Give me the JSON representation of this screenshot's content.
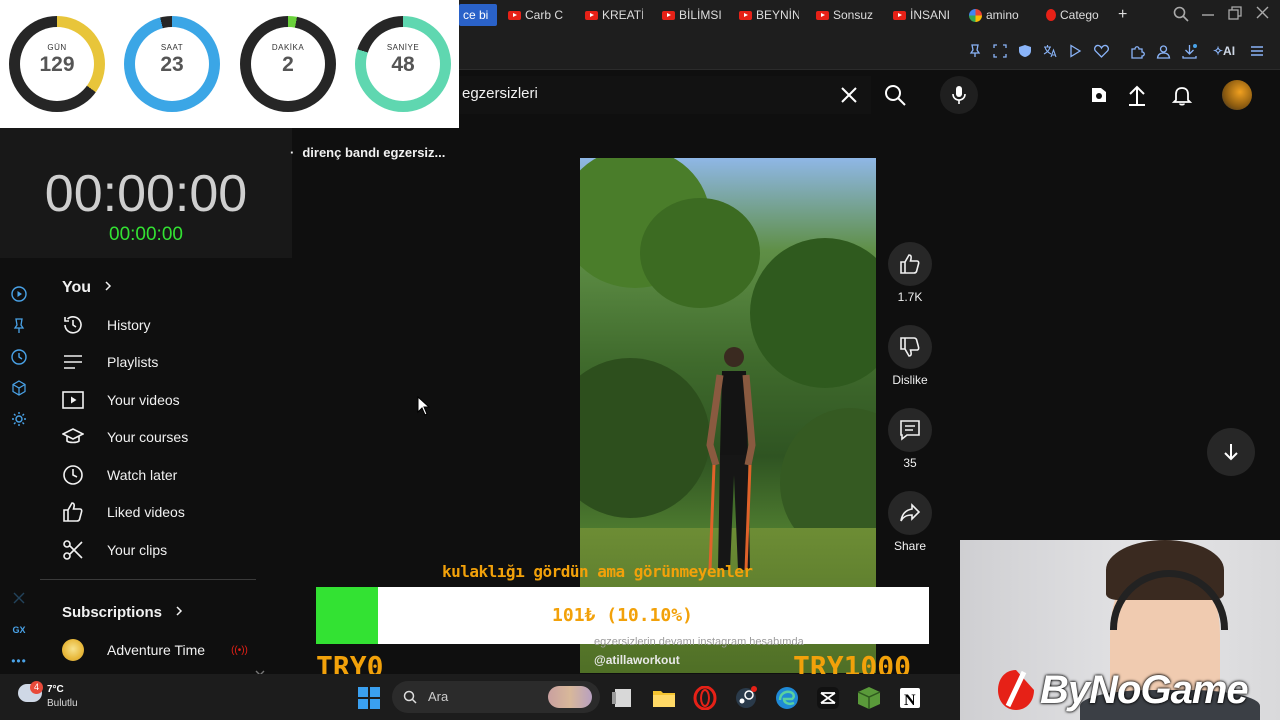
{
  "timer_overlay": {
    "gauges": [
      {
        "label": "GÜN",
        "value": "129",
        "fraction": 0.35,
        "color": "#e8c53a"
      },
      {
        "label": "SAAT",
        "value": "23",
        "fraction": 0.96,
        "color": "#3ba6e6"
      },
      {
        "label": "DAKİKA",
        "value": "2",
        "fraction": 0.03,
        "color": "#6ad13b"
      },
      {
        "label": "SANİYE",
        "value": "48",
        "fraction": 0.8,
        "color": "#5fd7b0"
      }
    ],
    "main_time": "00:00:00",
    "sub_time": "00:00:00"
  },
  "browser": {
    "tabs": [
      {
        "label": "ce bi",
        "icon": "none",
        "active": true
      },
      {
        "label": "Carb C",
        "icon": "youtube-icon"
      },
      {
        "label": "KREATİ",
        "icon": "youtube-icon"
      },
      {
        "label": "BİLİMSI",
        "icon": "youtube-icon"
      },
      {
        "label": "BEYNİN",
        "icon": "youtube-icon"
      },
      {
        "label": "Sonsuz",
        "icon": "youtube-icon"
      },
      {
        "label": "İNSANI",
        "icon": "youtube-icon"
      },
      {
        "label": "amino",
        "icon": "google-icon"
      },
      {
        "label": "Catego",
        "icon": "fire-icon"
      }
    ],
    "new_tab": "+",
    "extension_ai_label": "AI"
  },
  "youtube": {
    "search": {
      "value": "egzersizleri"
    },
    "chip_title": "direnç bandı egzersiz...",
    "guide": {
      "you_label": "You",
      "items": [
        {
          "label": "History",
          "icon": "history-icon"
        },
        {
          "label": "Playlists",
          "icon": "playlists-icon"
        },
        {
          "label": "Your videos",
          "icon": "your-videos-icon"
        },
        {
          "label": "Your courses",
          "icon": "courses-icon"
        },
        {
          "label": "Watch later",
          "icon": "clock-icon"
        },
        {
          "label": "Liked videos",
          "icon": "thumbs-up-icon"
        },
        {
          "label": "Your clips",
          "icon": "scissors-icon"
        }
      ],
      "subscriptions_label": "Subscriptions",
      "subscriptions": [
        {
          "label": "Adventure Time"
        }
      ]
    },
    "short": {
      "like_count": "1.7K",
      "dislike_label": "Dislike",
      "comment_count": "35",
      "share_label": "Share",
      "caption_line": "egzersizlerin devamı instagram hesabımda",
      "handle": "@atillaworkout"
    },
    "rail_label": "GX"
  },
  "donation": {
    "caption": "kulaklığı gördün ama görünmeyenler",
    "amount_text": "101₺ (10.10%)",
    "fraction": 0.101,
    "min_label": "TRY0",
    "max_label": "TRY1000"
  },
  "webcam": {
    "brand": "ByNoGame"
  },
  "taskbar": {
    "weather_temp": "7°C",
    "weather_desc": "Bulutlu",
    "weather_badge": "4",
    "search_placeholder": "Ara"
  }
}
